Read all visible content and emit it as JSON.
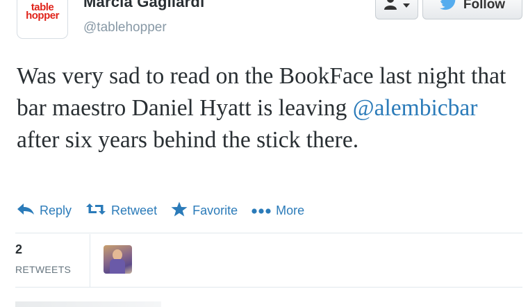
{
  "account": {
    "name": "Marcia Gagliardi",
    "handle": "@tablehopper",
    "logo_line1": "table",
    "logo_line2": "hopper"
  },
  "header": {
    "follow_label": "Follow"
  },
  "tweet": {
    "text_before": "Was very sad to read on the BookFace last night that bar maestro Daniel Hyatt is leaving ",
    "mention": "@alembicbar",
    "text_after": " after six years behind the stick there."
  },
  "actions": {
    "reply": "Reply",
    "retweet": "Retweet",
    "favorite": "Favorite",
    "more": "More"
  },
  "stats": {
    "retweet_count": "2",
    "retweet_label": "RETWEETS"
  },
  "colors": {
    "link": "#2b7bb9",
    "twitter_bird": "#55acee",
    "logo_red": "#e0241b"
  }
}
